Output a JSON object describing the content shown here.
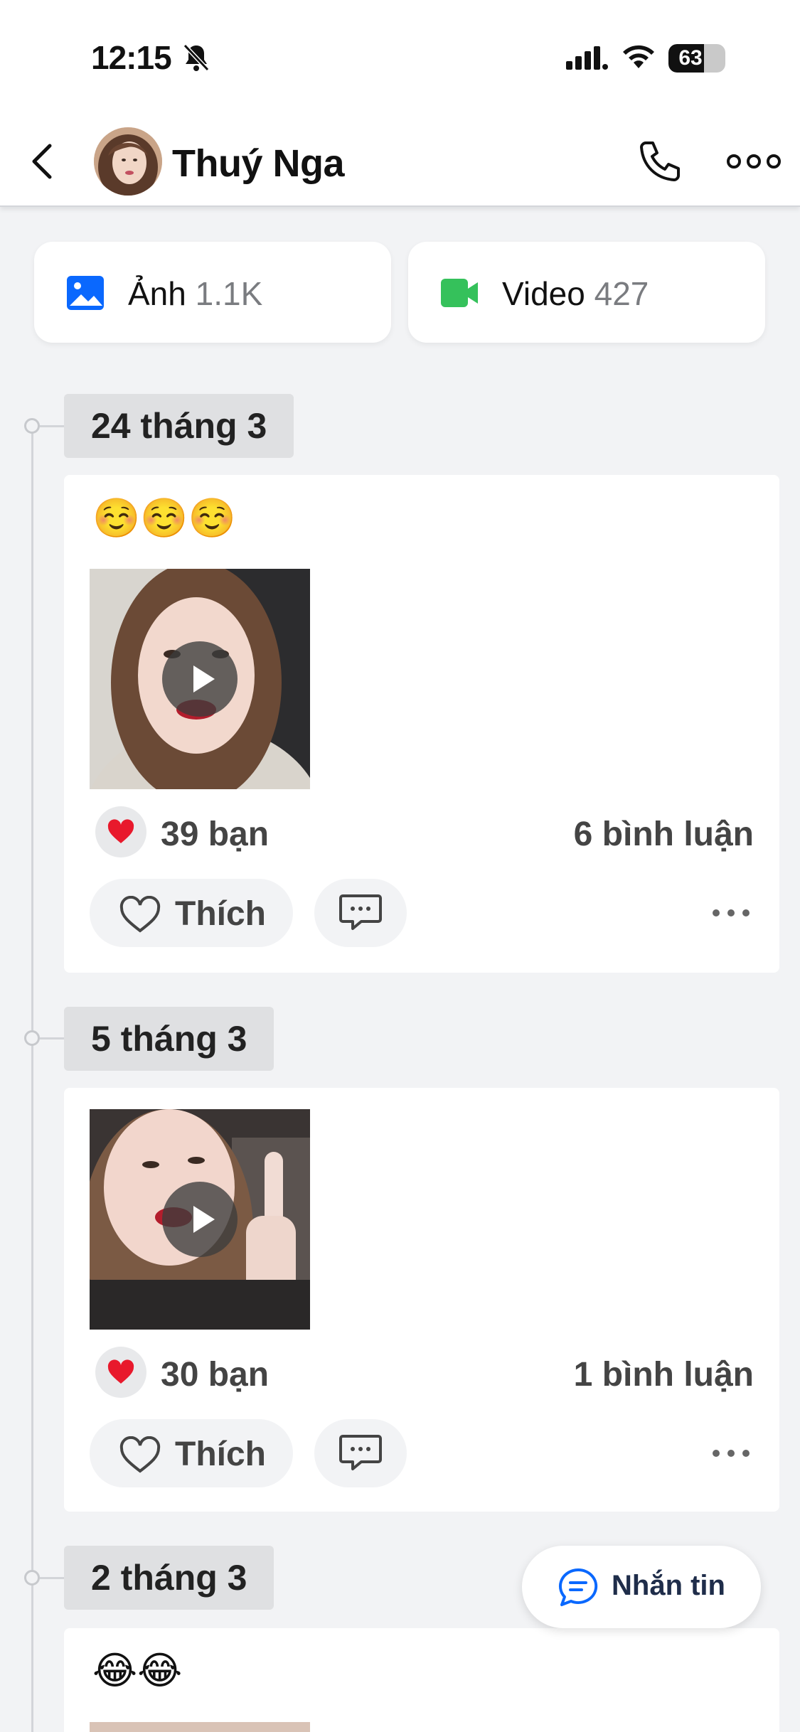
{
  "status_bar": {
    "time": "12:15",
    "battery": "63",
    "battery_level": 0.63
  },
  "header": {
    "title": "Thuý Nga"
  },
  "media": {
    "photo": {
      "label": "Ảnh",
      "count": "1.1K"
    },
    "video": {
      "label": "Video",
      "count": "427"
    }
  },
  "timeline": [
    {
      "date": "24 tháng 3",
      "text": "☺️☺️☺️",
      "reactions": "39 bạn",
      "comments": "6 bình luận",
      "like_label": "Thích"
    },
    {
      "date": "5 tháng 3",
      "text": "",
      "reactions": "30 bạn",
      "comments": "1 bình luận",
      "like_label": "Thích"
    },
    {
      "date": "2 tháng 3",
      "text": "😂😂"
    }
  ],
  "floating_button": {
    "label": "Nhắn tin"
  },
  "colors": {
    "accent": "#0a68fe",
    "video_green": "#35c15b",
    "heart_red": "#e8192c",
    "background": "#f2f3f5"
  }
}
